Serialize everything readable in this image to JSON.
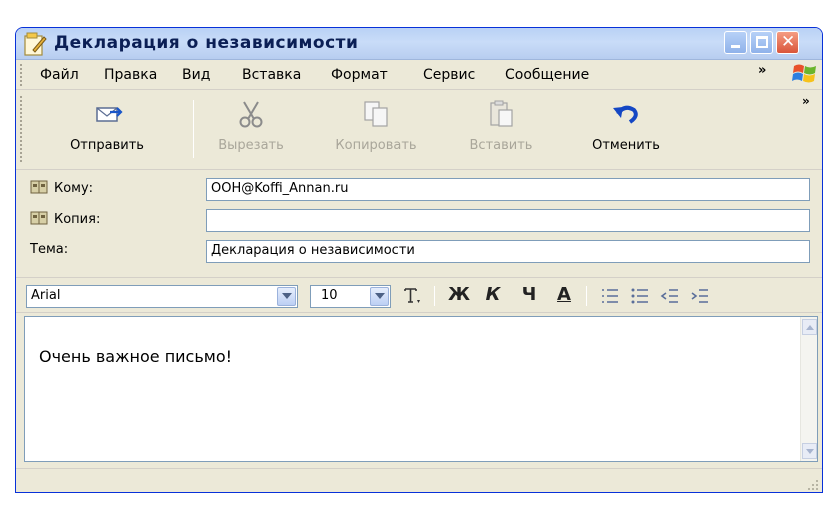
{
  "window": {
    "title": "Декларация о независимости",
    "title_icon": "document-pencil-icon"
  },
  "menu": {
    "items": [
      "Файл",
      "Правка",
      "Вид",
      "Вставка",
      "Формат",
      "Сервис",
      "Сообщение"
    ],
    "overflow": "»"
  },
  "toolbar": {
    "send": "Отправить",
    "cut": "Вырезать",
    "copy": "Копировать",
    "paste": "Вставить",
    "undo": "Отменить",
    "overflow": "»"
  },
  "fields": {
    "to_label": "Кому:",
    "to_value": "OOH@Koffi_Annan.ru",
    "cc_label": "Копия:",
    "cc_value": "",
    "subject_label": "Тема:",
    "subject_value": "Декларация о независимости"
  },
  "format": {
    "font": "Arial",
    "size": "10",
    "bold": "Ж",
    "italic": "К",
    "underline": "Ч",
    "font_color": "A"
  },
  "body": {
    "text": "Очень важное письмо!"
  },
  "colors": {
    "titlebar": "#c9dcf8",
    "window_bg": "#ece9d8",
    "close_button": "#d9553a",
    "input_border": "#7f9db9"
  }
}
